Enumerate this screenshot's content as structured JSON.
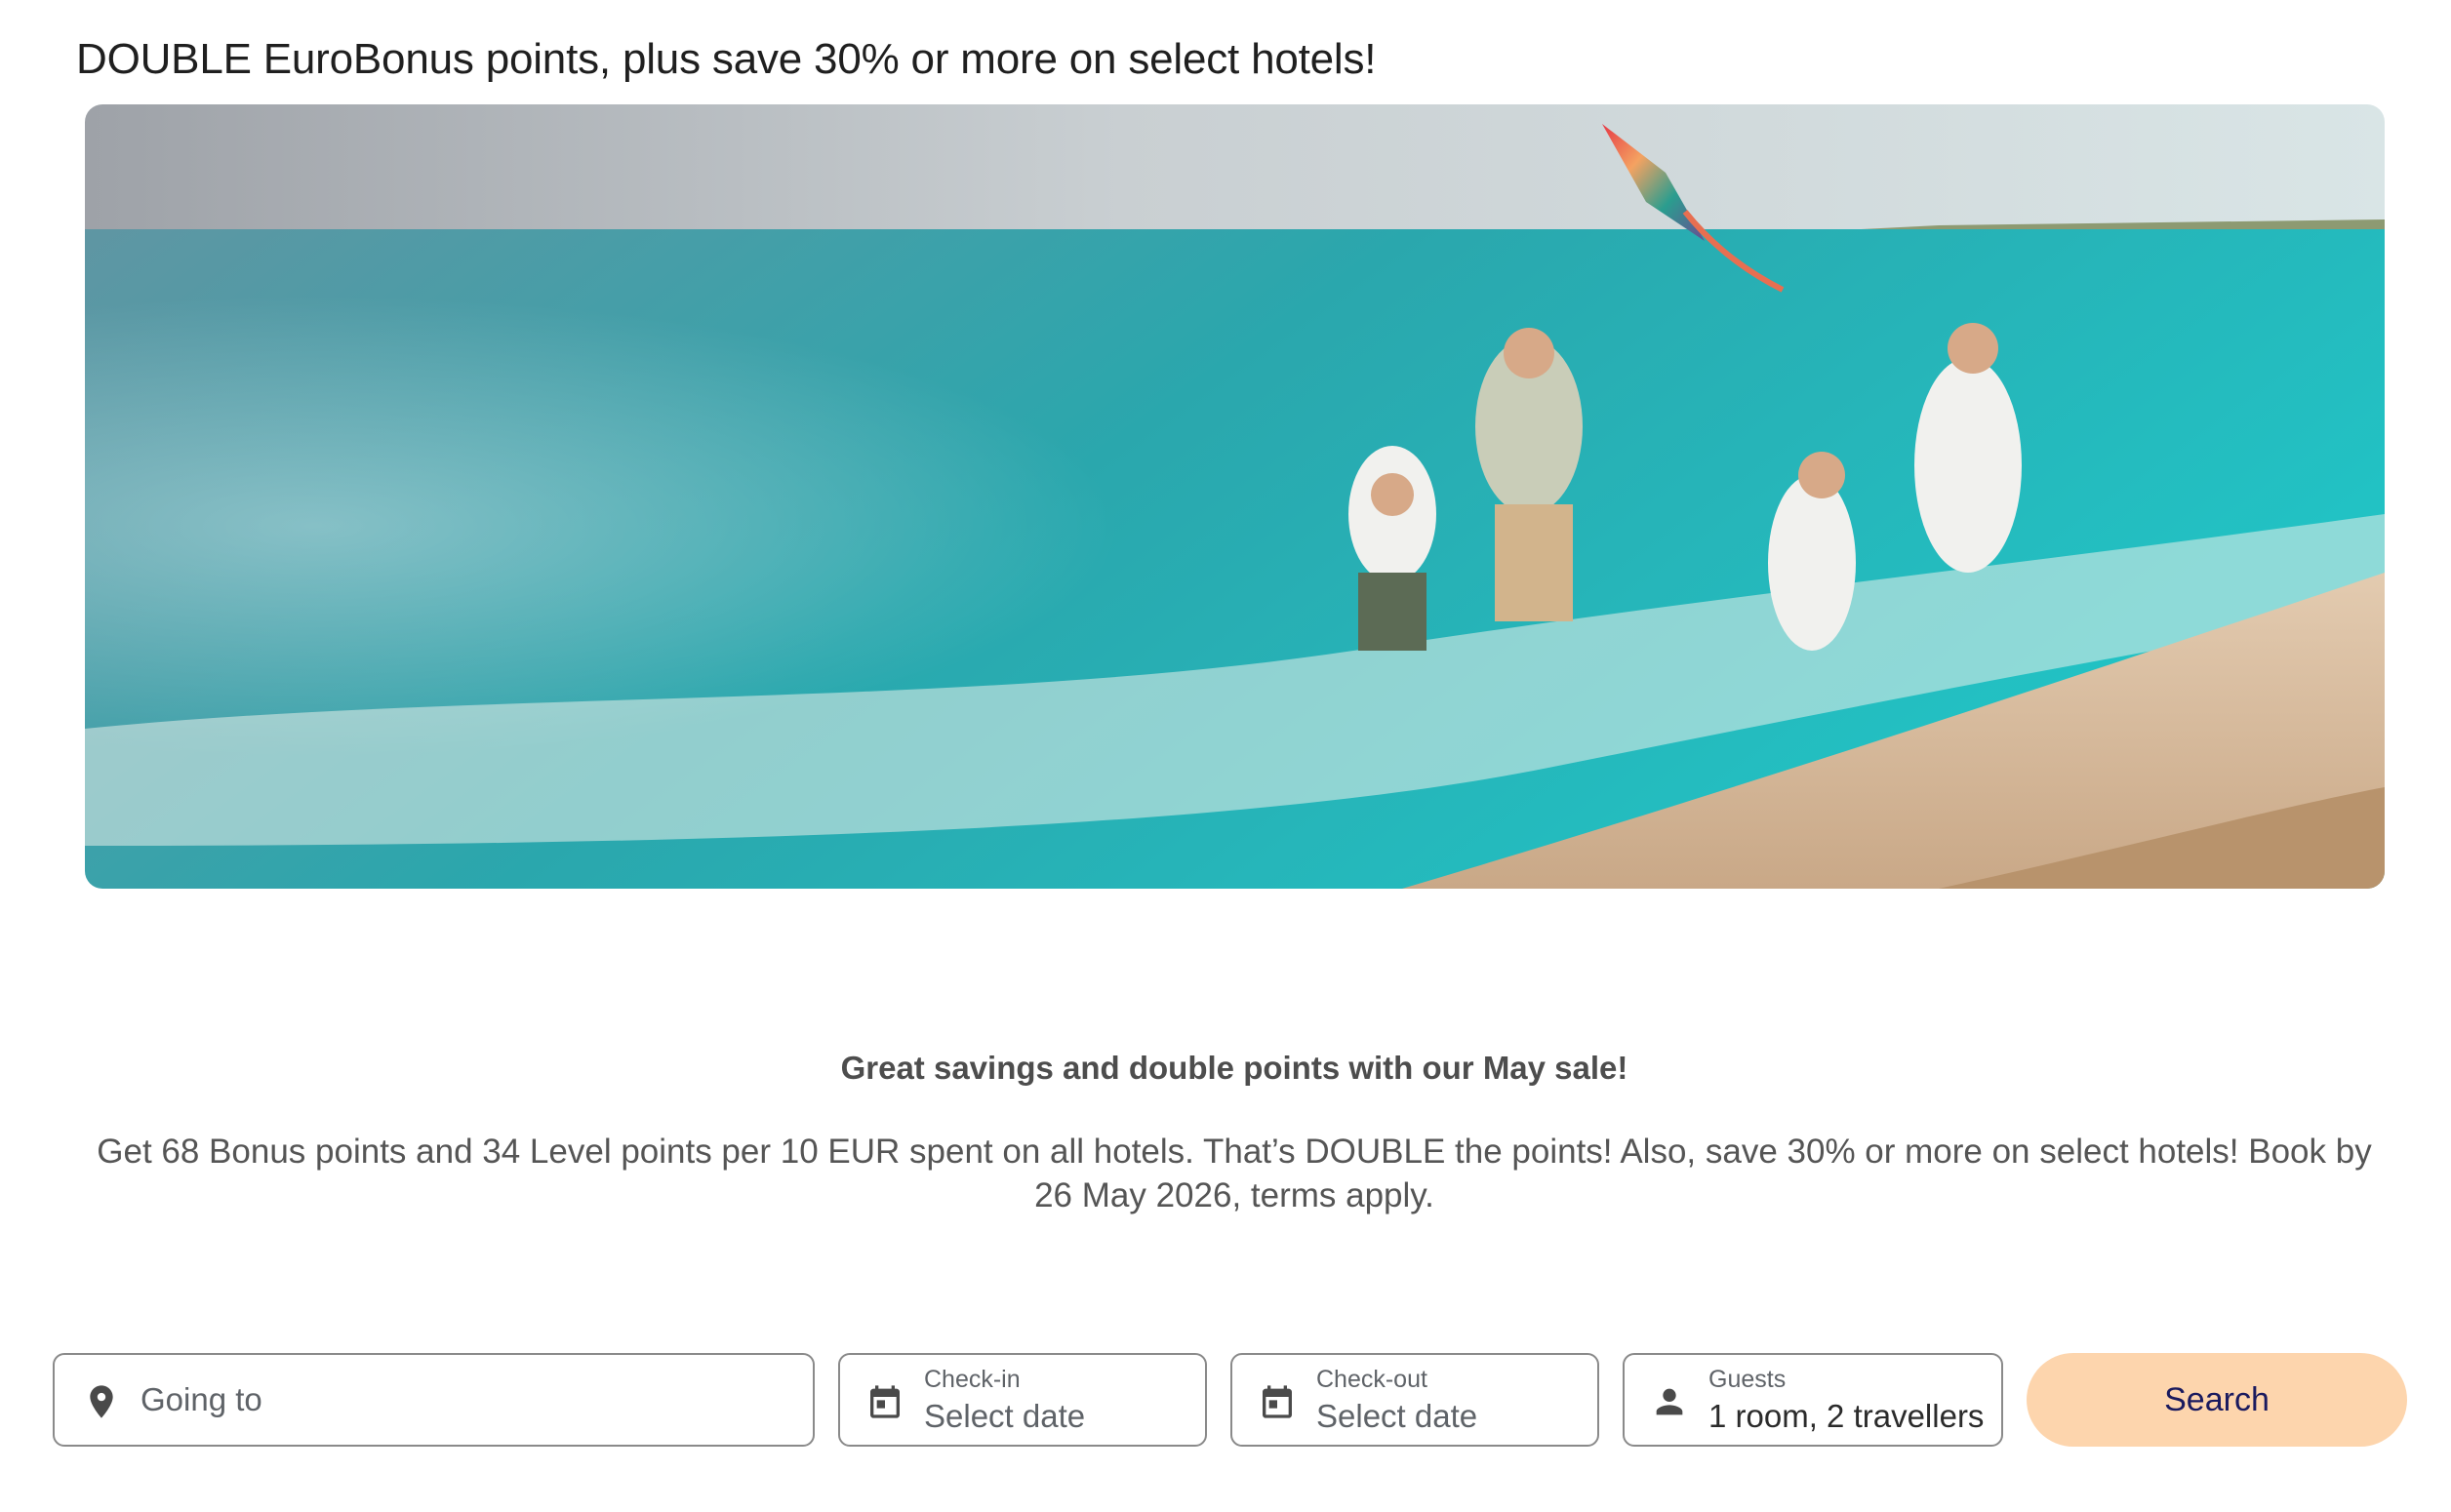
{
  "promo": {
    "headline": "DOUBLE EuroBonus points, plus save 30% or more on select hotels!",
    "subtitle": "Great savings and double points with our May sale!",
    "body": "Get 68 Bonus points and 34 Level points per 10 EUR spent on all hotels. That’s DOUBLE the points! Also, save 30% or more on select hotels! Book by 26 May 2026, terms apply."
  },
  "search_form": {
    "destination": {
      "placeholder": "Going to",
      "icon": "map-pin-icon"
    },
    "checkin": {
      "label": "Check-in",
      "value": "Select date",
      "icon": "calendar-icon"
    },
    "checkout": {
      "label": "Check-out",
      "value": "Select date",
      "icon": "calendar-icon"
    },
    "guests": {
      "label": "Guests",
      "value": "1 room, 2 travellers",
      "icon": "person-icon"
    },
    "search_label": "Search"
  },
  "colors": {
    "search_button_bg": "#fdd5ad",
    "search_button_text": "#1a1a5e",
    "field_border": "#8a8a8a"
  }
}
